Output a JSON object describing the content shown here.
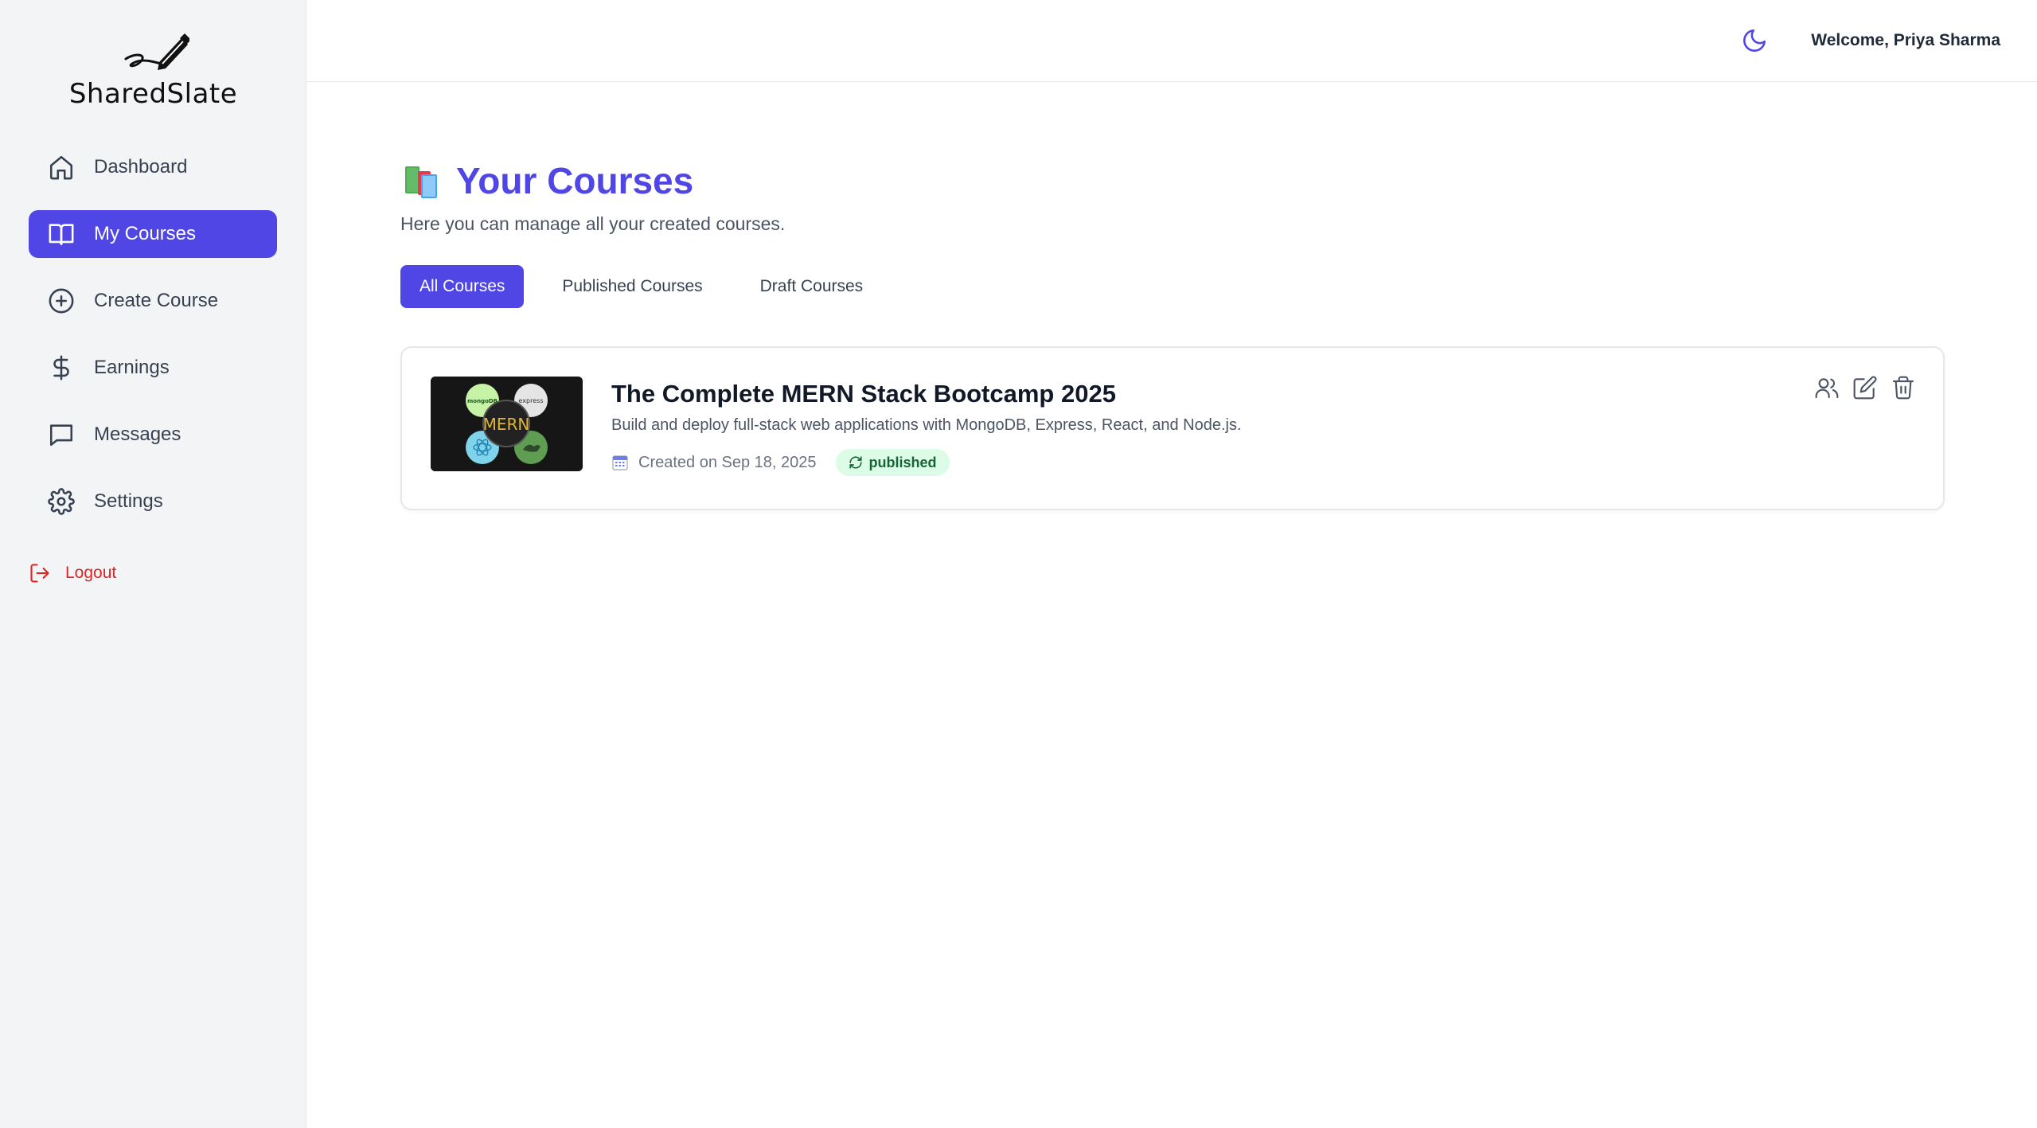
{
  "brand": {
    "name": "SharedSlate"
  },
  "sidebar": {
    "items": [
      {
        "label": "Dashboard",
        "icon": "home-icon",
        "active": false
      },
      {
        "label": "My Courses",
        "icon": "book-open-icon",
        "active": true
      },
      {
        "label": "Create Course",
        "icon": "plus-circle-icon",
        "active": false
      },
      {
        "label": "Earnings",
        "icon": "dollar-icon",
        "active": false
      },
      {
        "label": "Messages",
        "icon": "message-icon",
        "active": false
      },
      {
        "label": "Settings",
        "icon": "gear-icon",
        "active": false
      }
    ],
    "logout_label": "Logout"
  },
  "header": {
    "welcome": "Welcome, Priya Sharma",
    "theme_icon": "moon-icon"
  },
  "main": {
    "title": "Your Courses",
    "subtitle": "Here you can manage all your created courses.",
    "tabs": [
      {
        "label": "All Courses",
        "active": true
      },
      {
        "label": "Published Courses",
        "active": false
      },
      {
        "label": "Draft Courses",
        "active": false
      }
    ],
    "courses": [
      {
        "title": "The Complete MERN Stack Bootcamp 2025",
        "description": "Build and deploy full-stack web applications with MongoDB, Express, React, and Node.js.",
        "created": "Created on Sep 18, 2025",
        "status": "published",
        "thumbnail": {
          "center": "MERN",
          "top_left": "mongoDB",
          "top_right": "express"
        }
      }
    ]
  },
  "colors": {
    "accent": "#4f46e5",
    "sidebar_bg": "#f3f4f6",
    "logout": "#dc2626",
    "badge_bg": "#dcfce7",
    "badge_text": "#166534"
  }
}
